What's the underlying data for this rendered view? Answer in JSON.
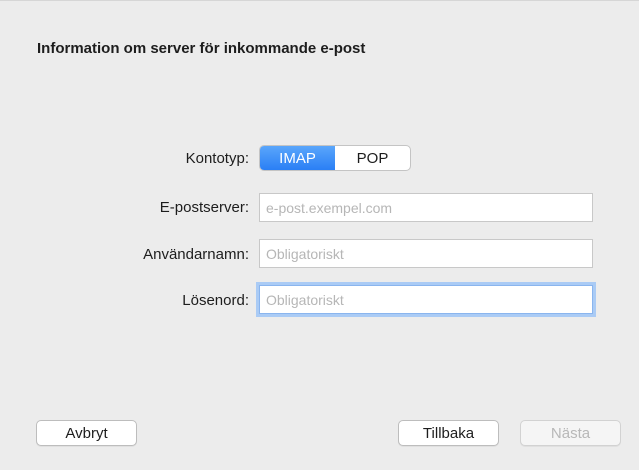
{
  "dialog": {
    "heading": "Information om server för inkommande e-post"
  },
  "form": {
    "account_type_label": "Kontotyp:",
    "account_types": [
      {
        "label": "IMAP",
        "selected": true
      },
      {
        "label": "POP",
        "selected": false
      }
    ],
    "mail_server_label": "E-postserver:",
    "mail_server_value": "",
    "mail_server_placeholder": "e-post.exempel.com",
    "username_label": "Användarnamn:",
    "username_value": "",
    "username_placeholder": "Obligatoriskt",
    "password_label": "Lösenord:",
    "password_value": "",
    "password_placeholder": "Obligatoriskt"
  },
  "buttons": {
    "cancel_label": "Avbryt",
    "back_label": "Tillbaka",
    "next_label": "Nästa",
    "next_enabled": false
  },
  "colors": {
    "accent": "#2a7ff5",
    "focus_ring": "#aacbf5",
    "background": "#ececec"
  }
}
